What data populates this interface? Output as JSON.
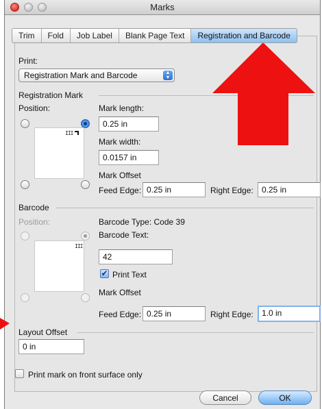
{
  "window": {
    "title": "Marks"
  },
  "tabs": [
    {
      "label": "Trim",
      "active": false
    },
    {
      "label": "Fold",
      "active": false
    },
    {
      "label": "Job Label",
      "active": false
    },
    {
      "label": "Blank Page Text",
      "active": false
    },
    {
      "label": "Registration and Barcode",
      "active": true
    }
  ],
  "print": {
    "label": "Print:",
    "selected": "Registration Mark and Barcode"
  },
  "registration": {
    "section_label": "Registration Mark",
    "position_label": "Position:",
    "mark_length_label": "Mark length:",
    "mark_length_value": "0.25 in",
    "mark_width_label": "Mark width:",
    "mark_width_value": "0.0157 in",
    "mark_offset_label": "Mark Offset",
    "feed_edge_label": "Feed Edge:",
    "feed_edge_value": "0.25 in",
    "right_edge_label": "Right Edge:",
    "right_edge_value": "0.25 in",
    "preview_marks": "III"
  },
  "barcode": {
    "section_label": "Barcode",
    "position_label": "Position:",
    "type_text": "Barcode Type: Code 39",
    "text_label": "Barcode Text:",
    "text_value": "42",
    "print_text_label": "Print Text",
    "print_text_checked": true,
    "mark_offset_label": "Mark Offset",
    "feed_edge_label": "Feed Edge:",
    "feed_edge_value": "0.25 in",
    "right_edge_label": "Right Edge:",
    "right_edge_value": "1.0 in",
    "preview_marks": "III"
  },
  "layout_offset": {
    "label": "Layout Offset",
    "value": "0 in"
  },
  "front_surface": {
    "label": "Print mark on front surface only",
    "checked": false
  },
  "buttons": {
    "cancel": "Cancel",
    "ok": "OK"
  },
  "checkmark_glyph": "✔",
  "colors": {
    "arrow": "#ee1111",
    "active_tab": "#8ec0f0",
    "default_button": "#6fb0f1"
  }
}
